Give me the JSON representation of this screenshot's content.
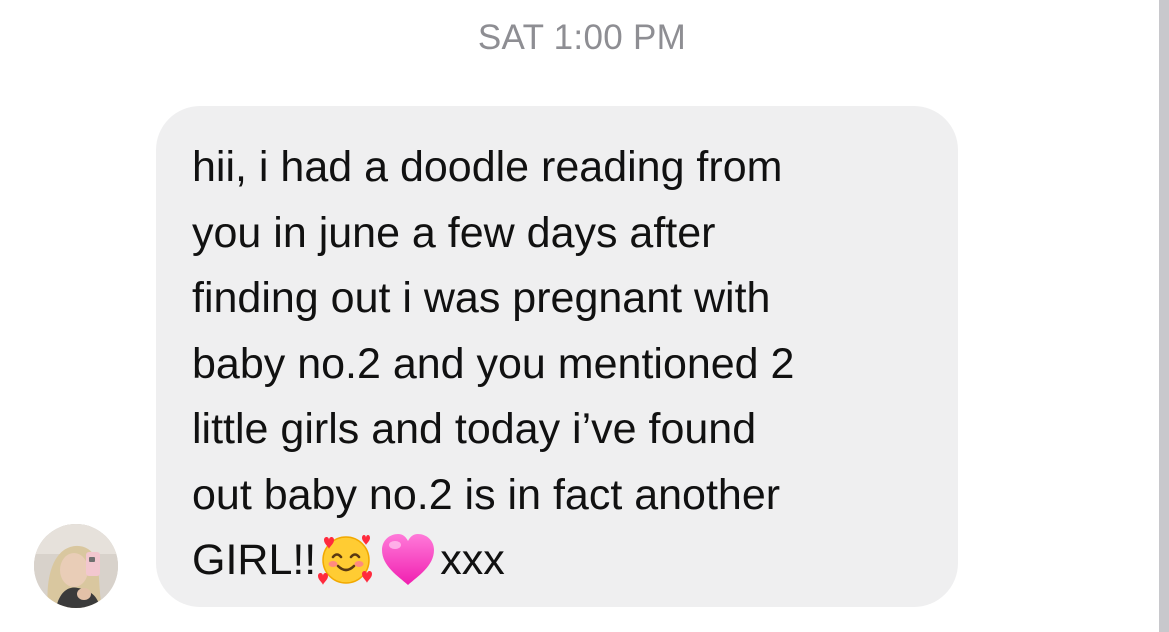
{
  "thread": {
    "timestamp": "SAT 1:00 PM"
  },
  "message": {
    "sender_avatar": "profile-photo",
    "lines": [
      "hii, i had a doodle reading from",
      "you in june a few days after",
      "finding out i was pregnant with",
      "baby no.2 and you mentioned 2",
      "little girls and today i’ve found",
      "out baby no.2 is in fact another"
    ],
    "last_line": {
      "text_before": "GIRL!!",
      "emojis": [
        "smiling-face-with-hearts-emoji",
        "pink-heart-emoji"
      ],
      "text_after": "xxx"
    }
  },
  "colors": {
    "bubble": "#efeff0",
    "text": "#111111",
    "timestamp": "#8e8e93"
  }
}
